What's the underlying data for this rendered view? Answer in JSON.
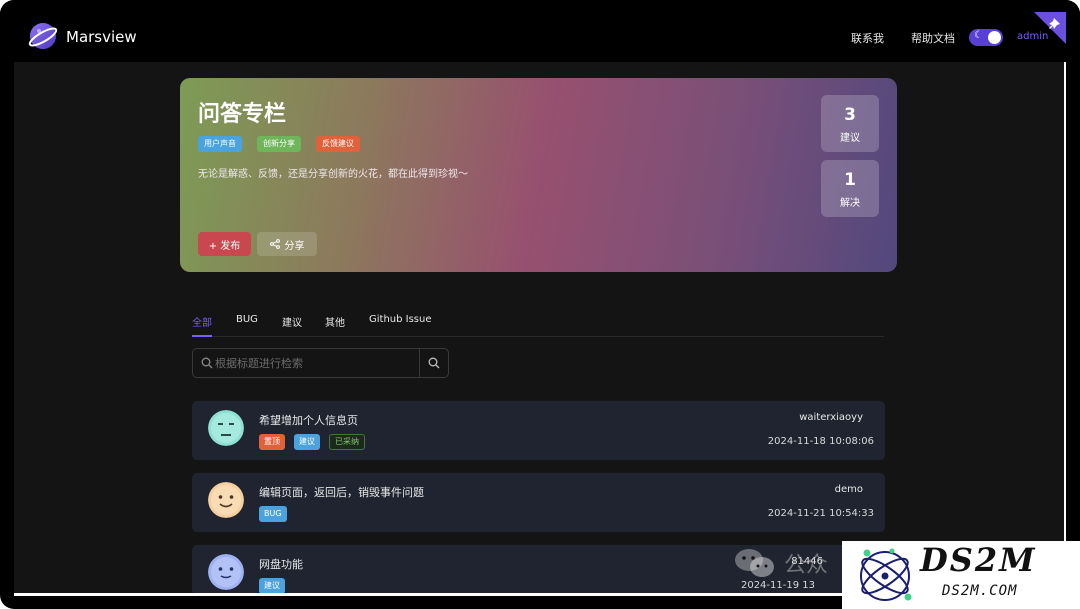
{
  "header": {
    "brand": "Marsview",
    "nav": [
      "联系我",
      "帮助文档"
    ],
    "user": "admin"
  },
  "hero": {
    "title": "问答专栏",
    "tags": [
      {
        "label": "用户声音",
        "color": "#4aa3df"
      },
      {
        "label": "创新分享",
        "color": "#6fb55a"
      },
      {
        "label": "反馈建议",
        "color": "#e0613a"
      }
    ],
    "description": "无论是解惑、反馈，还是分享创新的火花，都在此得到珍视～",
    "publish_label": "+ 发布",
    "share_label": "分享",
    "stats": [
      {
        "value": "3",
        "label": "建议"
      },
      {
        "value": "1",
        "label": "解决"
      }
    ]
  },
  "tabs": [
    "全部",
    "BUG",
    "建议",
    "其他",
    "Github Issue"
  ],
  "active_tab": "全部",
  "search": {
    "placeholder": "根据标题进行检索"
  },
  "posts": [
    {
      "title": "希望增加个人信息页",
      "author": "waiterxiaoyy",
      "date": "2024-11-18 10:08:06",
      "avatar_color": "#8fe0d4",
      "tags": [
        {
          "label": "置顶",
          "color": "#e0613a"
        },
        {
          "label": "建议",
          "color": "#4aa3df"
        },
        {
          "label": "已采纳",
          "color": "outline-green"
        }
      ]
    },
    {
      "title": "编辑页面，返回后，销毁事件问题",
      "author": "demo",
      "date": "2024-11-21 10:54:33",
      "avatar_color": "#f5cf9e",
      "tags": [
        {
          "label": "BUG",
          "color": "#4aa3df"
        }
      ]
    },
    {
      "title": "网盘功能",
      "author": "81446",
      "date": "2024-11-19 13",
      "avatar_color": "#9fb1f2",
      "tags": [
        {
          "label": "建议",
          "color": "#4aa3df"
        }
      ]
    }
  ],
  "watermark": {
    "main": "DS2M",
    "sub": "DS2M.COM",
    "ghost": "公众"
  },
  "colors": {
    "accent": "#7b5cff",
    "card_bg": "#1f2430",
    "publish": "#c9474f"
  }
}
